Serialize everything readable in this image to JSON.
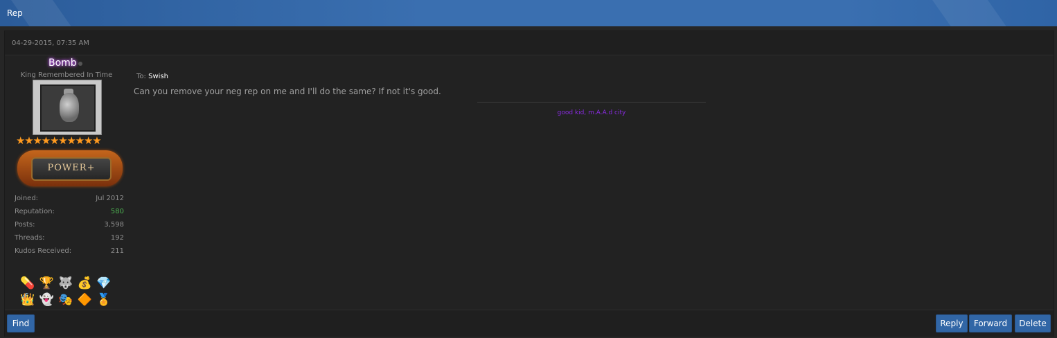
{
  "header": {
    "title": "Rep"
  },
  "post": {
    "date": "04-29-2015, 07:35 AM",
    "user": {
      "name": "Bomb",
      "title": "King Remembered In Time",
      "rank_badge": "POWER+",
      "stars": "★★★★★★★★★★",
      "star_color": "#ff9a1f",
      "name_glow_color": "#c04dff",
      "stats": [
        {
          "key": "Joined:",
          "value": "Jul 2012"
        },
        {
          "key": "Reputation:",
          "value": "580"
        },
        {
          "key": "Posts:",
          "value": "3,598"
        },
        {
          "key": "Threads:",
          "value": "192"
        },
        {
          "key": "Kudos Received:",
          "value": "211"
        }
      ],
      "awards_row1": [
        "💊",
        "🏆",
        "🐺",
        "💰",
        "💎",
        "🔨"
      ],
      "awards_row2": [
        "👑",
        "👻",
        "🎭",
        "🔶",
        "🏅"
      ]
    },
    "to_label": "To:",
    "to_name": "Swish",
    "message": "Can you remove your neg rep on me and I'll do the same? If not it's good.",
    "signature": "good kid, m.A.A.d city",
    "signature_color": "#8a2be2"
  },
  "buttons": {
    "find": "Find",
    "reply": "Reply",
    "forward": "Forward",
    "delete": "Delete"
  }
}
